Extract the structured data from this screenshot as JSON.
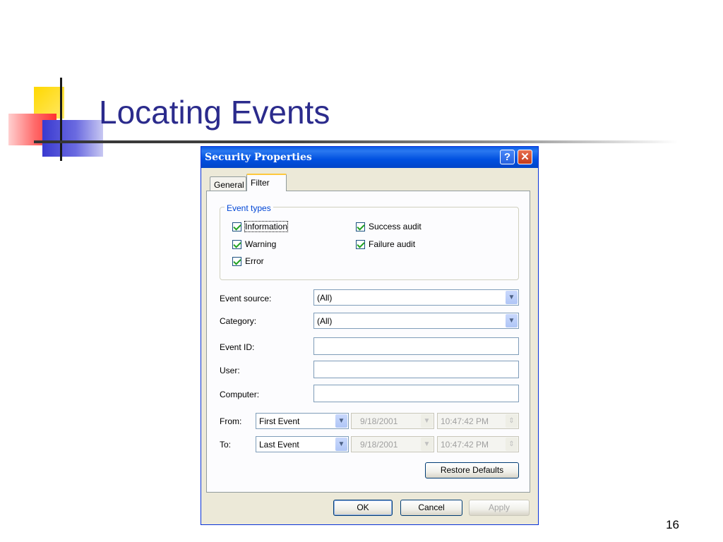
{
  "slide": {
    "title": "Locating Events",
    "page_number": "16"
  },
  "dialog": {
    "title": "Security Properties",
    "help_glyph": "?",
    "close_glyph": "✕",
    "tabs": [
      {
        "label": "General"
      },
      {
        "label": "Filter"
      }
    ],
    "event_types": {
      "label": "Event types",
      "items": [
        {
          "label": "Information",
          "checked": true
        },
        {
          "label": "Warning",
          "checked": true
        },
        {
          "label": "Error",
          "checked": true
        },
        {
          "label": "Success audit",
          "checked": true
        },
        {
          "label": "Failure audit",
          "checked": true
        }
      ]
    },
    "fields": {
      "event_source": {
        "label": "Event source:",
        "value": "(All)"
      },
      "category": {
        "label": "Category:",
        "value": "(All)"
      },
      "event_id": {
        "label": "Event ID:",
        "value": ""
      },
      "user": {
        "label": "User:",
        "value": ""
      },
      "computer": {
        "label": "Computer:",
        "value": ""
      }
    },
    "range": {
      "from": {
        "label": "From:",
        "selector": "First Event",
        "date": "9/18/2001",
        "time": "10:47:42 PM"
      },
      "to": {
        "label": "To:",
        "selector": "Last Event",
        "date": "9/18/2001",
        "time": "10:47:42 PM"
      }
    },
    "buttons": {
      "restore_defaults": "Restore Defaults",
      "ok": "OK",
      "cancel": "Cancel",
      "apply": "Apply"
    },
    "glyphs": {
      "dropdown": "▼",
      "spinner": "⇕"
    }
  }
}
